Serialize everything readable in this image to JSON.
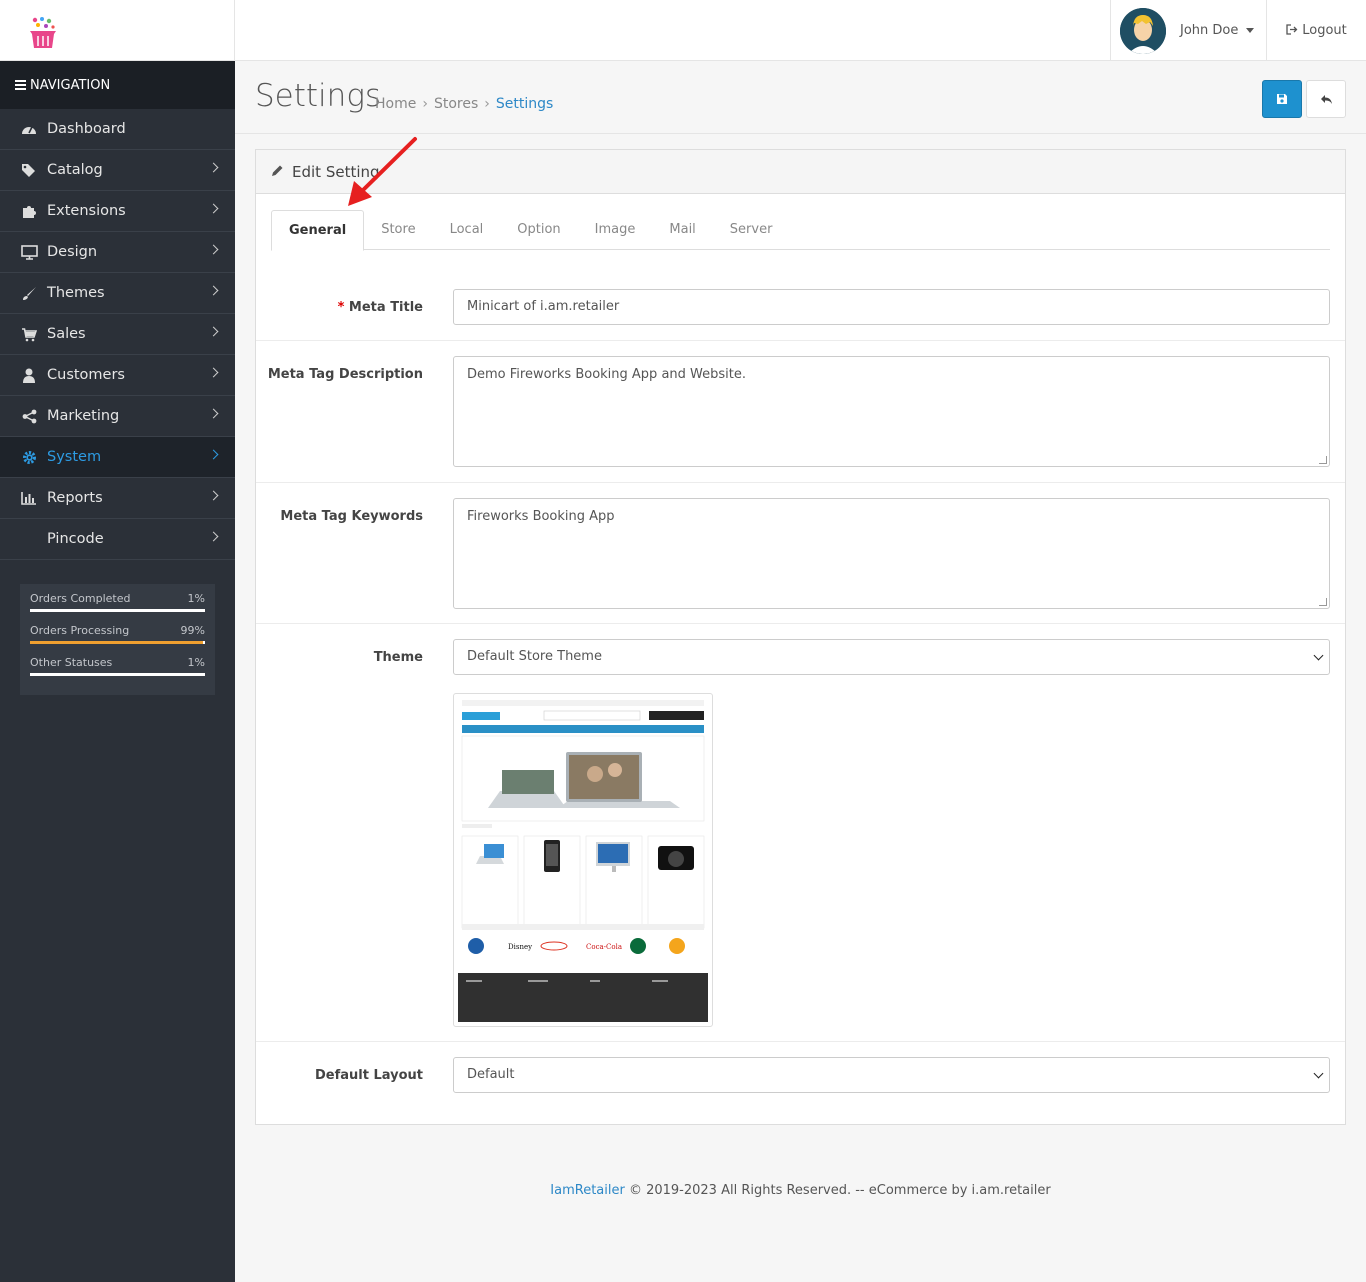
{
  "header": {
    "user_name": "John Doe",
    "logout_label": "Logout"
  },
  "sidebar": {
    "nav_title": "NAVIGATION",
    "items": [
      {
        "label": "Dashboard",
        "icon": "dashboard-icon"
      },
      {
        "label": "Catalog",
        "icon": "tags-icon"
      },
      {
        "label": "Extensions",
        "icon": "puzzle-icon"
      },
      {
        "label": "Design",
        "icon": "monitor-icon"
      },
      {
        "label": "Themes",
        "icon": "brush-icon"
      },
      {
        "label": "Sales",
        "icon": "cart-icon"
      },
      {
        "label": "Customers",
        "icon": "user-icon"
      },
      {
        "label": "Marketing",
        "icon": "share-icon"
      },
      {
        "label": "System",
        "icon": "gear-icon",
        "active": true
      },
      {
        "label": "Reports",
        "icon": "bar-chart-icon"
      },
      {
        "label": "Pincode",
        "icon": ""
      }
    ],
    "stats": [
      {
        "label": "Orders Completed",
        "value": "1%",
        "percent": 1,
        "color": "#ffffff"
      },
      {
        "label": "Orders Processing",
        "value": "99%",
        "percent": 99,
        "color": "#f0a030"
      },
      {
        "label": "Other Statuses",
        "value": "1%",
        "percent": 1,
        "color": "#ffffff"
      }
    ]
  },
  "page": {
    "title": "Settings",
    "breadcrumb": [
      "Home",
      "Stores",
      "Settings"
    ]
  },
  "panel": {
    "title": "Edit Setting",
    "tabs": [
      "General",
      "Store",
      "Local",
      "Option",
      "Image",
      "Mail",
      "Server"
    ],
    "active_tab": "General"
  },
  "form": {
    "meta_title_label": "Meta Title",
    "meta_title_value": "Minicart of i.am.retailer",
    "meta_desc_label": "Meta Tag Description",
    "meta_desc_value": "Demo Fireworks Booking App and Website.",
    "meta_keywords_label": "Meta Tag Keywords",
    "meta_keywords_value": "Fireworks Booking App",
    "theme_label": "Theme",
    "theme_value": "Default Store Theme",
    "layout_label": "Default Layout",
    "layout_value": "Default"
  },
  "footer": {
    "brand": "IamRetailer",
    "text": " © 2019-2023 All Rights Reserved. -- eCommerce by i.am.retailer"
  },
  "colors": {
    "accent": "#1e91cf",
    "sidebar_bg": "#2b3038",
    "active_nav": "#2d9be3"
  }
}
